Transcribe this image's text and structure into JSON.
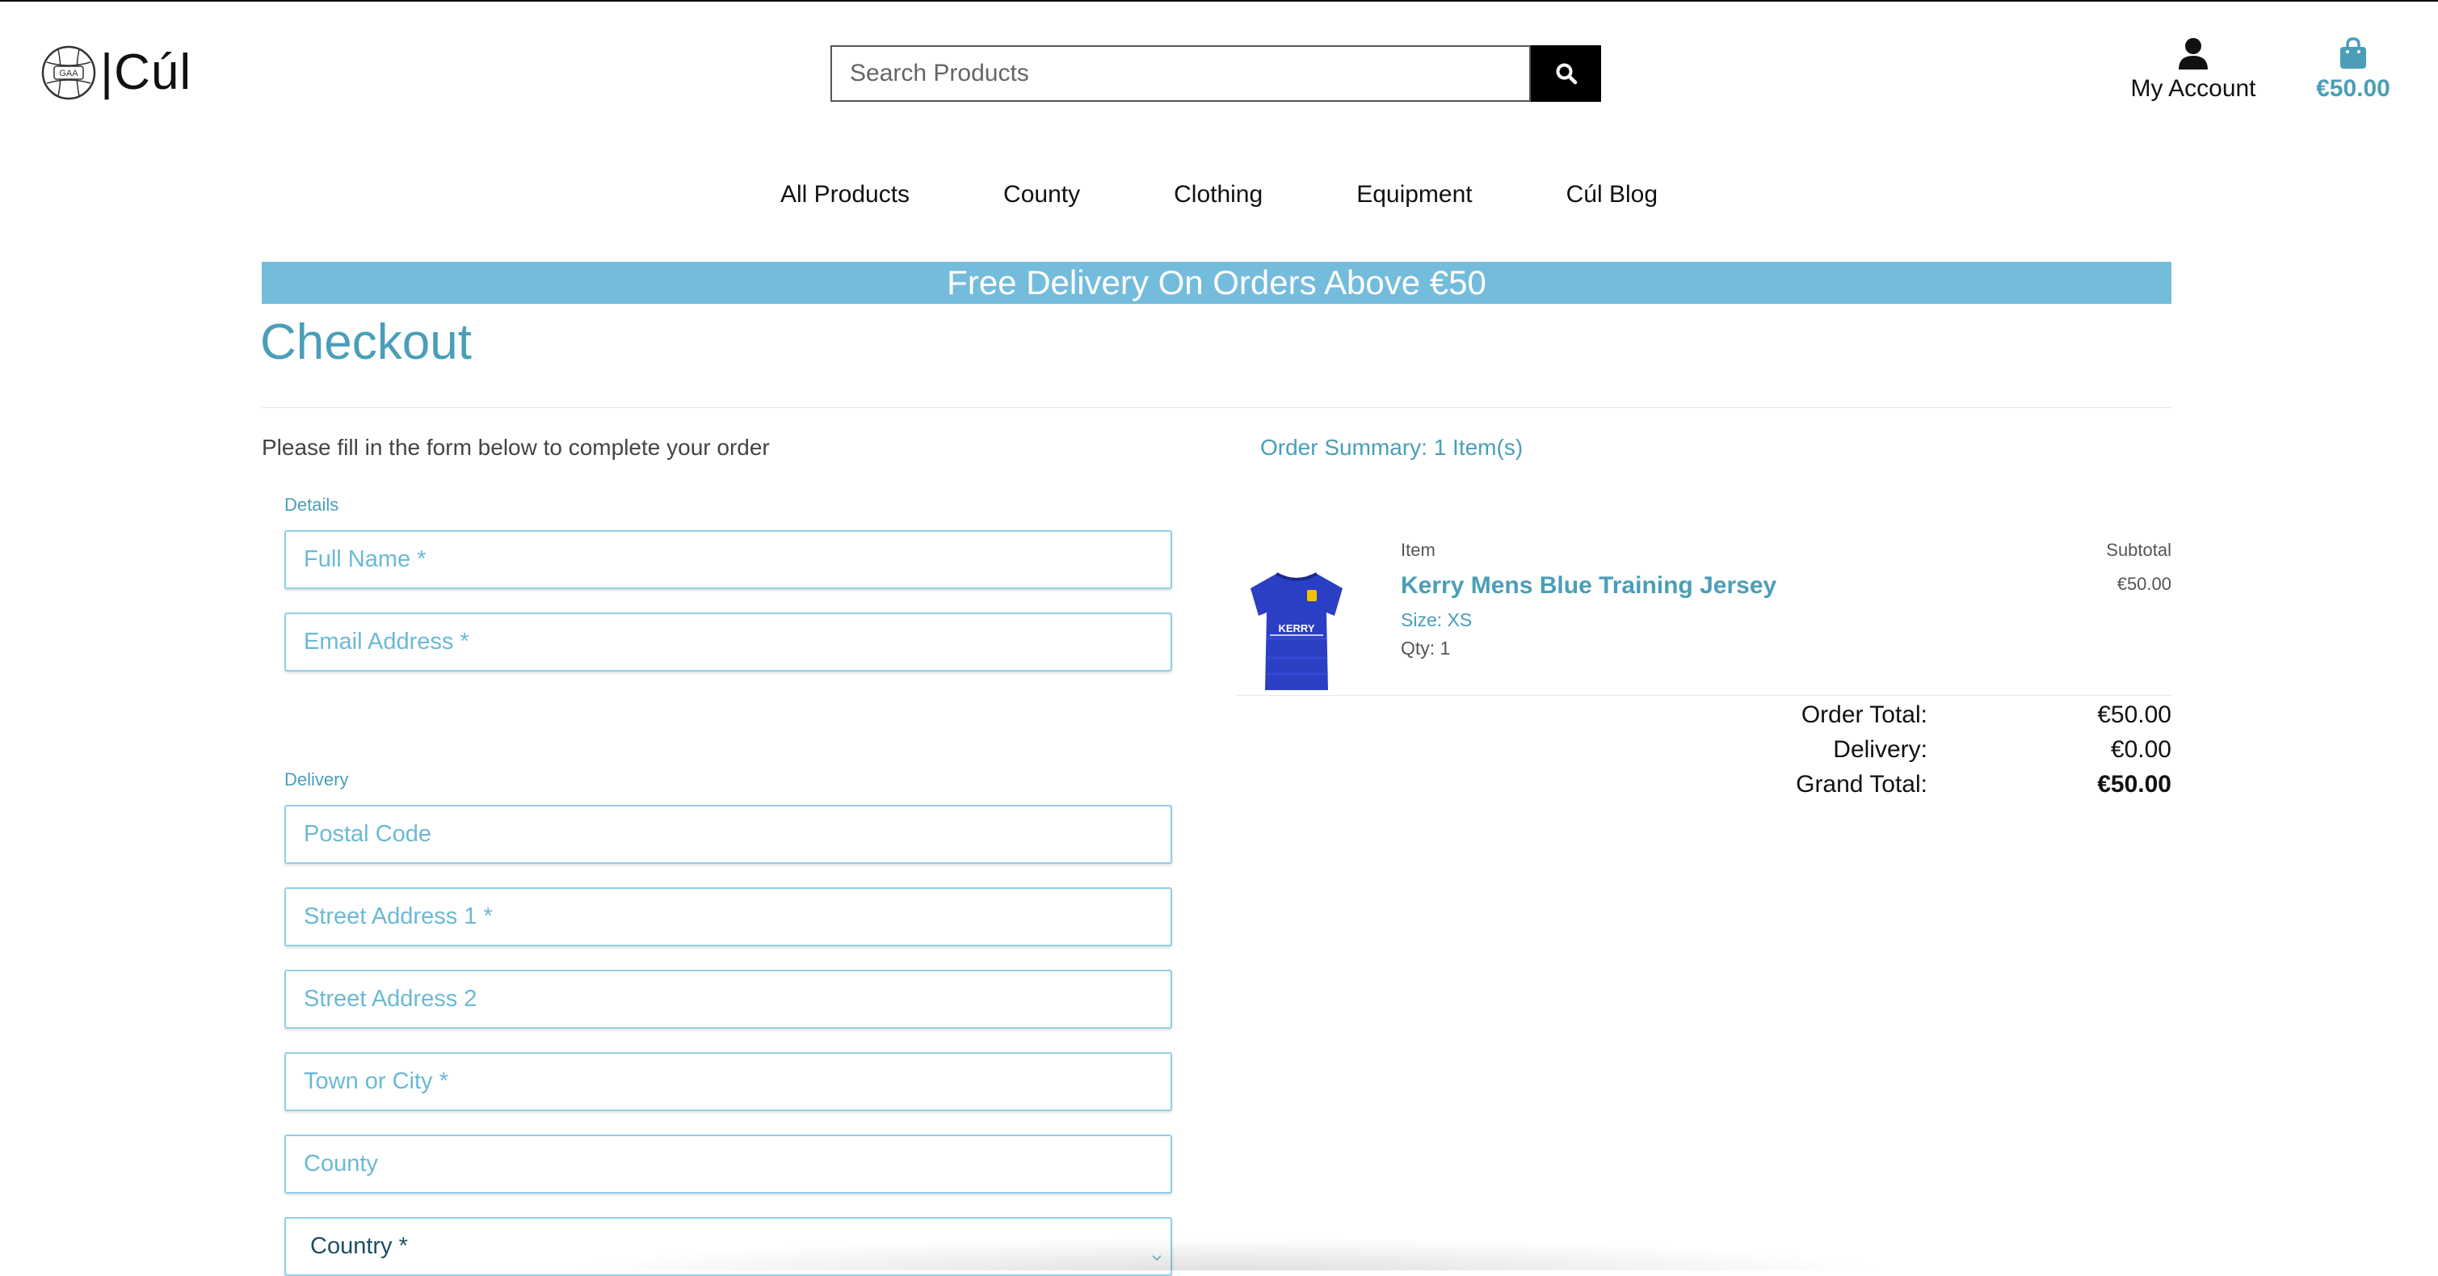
{
  "brand": {
    "logo_text": "|Cúl",
    "ball_text": "GAA"
  },
  "search": {
    "placeholder": "Search Products"
  },
  "account": {
    "label": "My Account"
  },
  "bag": {
    "amount": "€50.00"
  },
  "nav": {
    "items": [
      "All Products",
      "County",
      "Clothing",
      "Equipment",
      "Cúl Blog"
    ]
  },
  "banner": {
    "text": "Free Delivery On Orders Above €50"
  },
  "page": {
    "title": "Checkout",
    "intro": "Please fill in the form below to complete your order"
  },
  "form": {
    "details_legend": "Details",
    "full_name": "Full Name *",
    "email": "Email Address *",
    "delivery_legend": "Delivery",
    "postal_code": "Postal Code",
    "street1": "Street Address 1 *",
    "street2": "Street Address 2",
    "town": "Town or City *",
    "county": "County",
    "country": "Country *"
  },
  "summary": {
    "title": "Order Summary: 1 Item(s)",
    "item_header": "Item",
    "subtotal_header": "Subtotal",
    "item": {
      "name": "Kerry Mens Blue Training Jersey",
      "size": "Size: XS",
      "qty": "Qty: 1",
      "subtotal": "€50.00",
      "jersey_text": "KERRY"
    },
    "order_total_label": "Order Total:",
    "order_total": "€50.00",
    "delivery_label": "Delivery:",
    "delivery": "€0.00",
    "grand_total_label": "Grand Total:",
    "grand_total": "€50.00"
  },
  "colors": {
    "accent": "#4a9eb8",
    "banner": "#74bcdc",
    "field_border": "#8fd0e8",
    "jersey": "#2b3fc4"
  }
}
